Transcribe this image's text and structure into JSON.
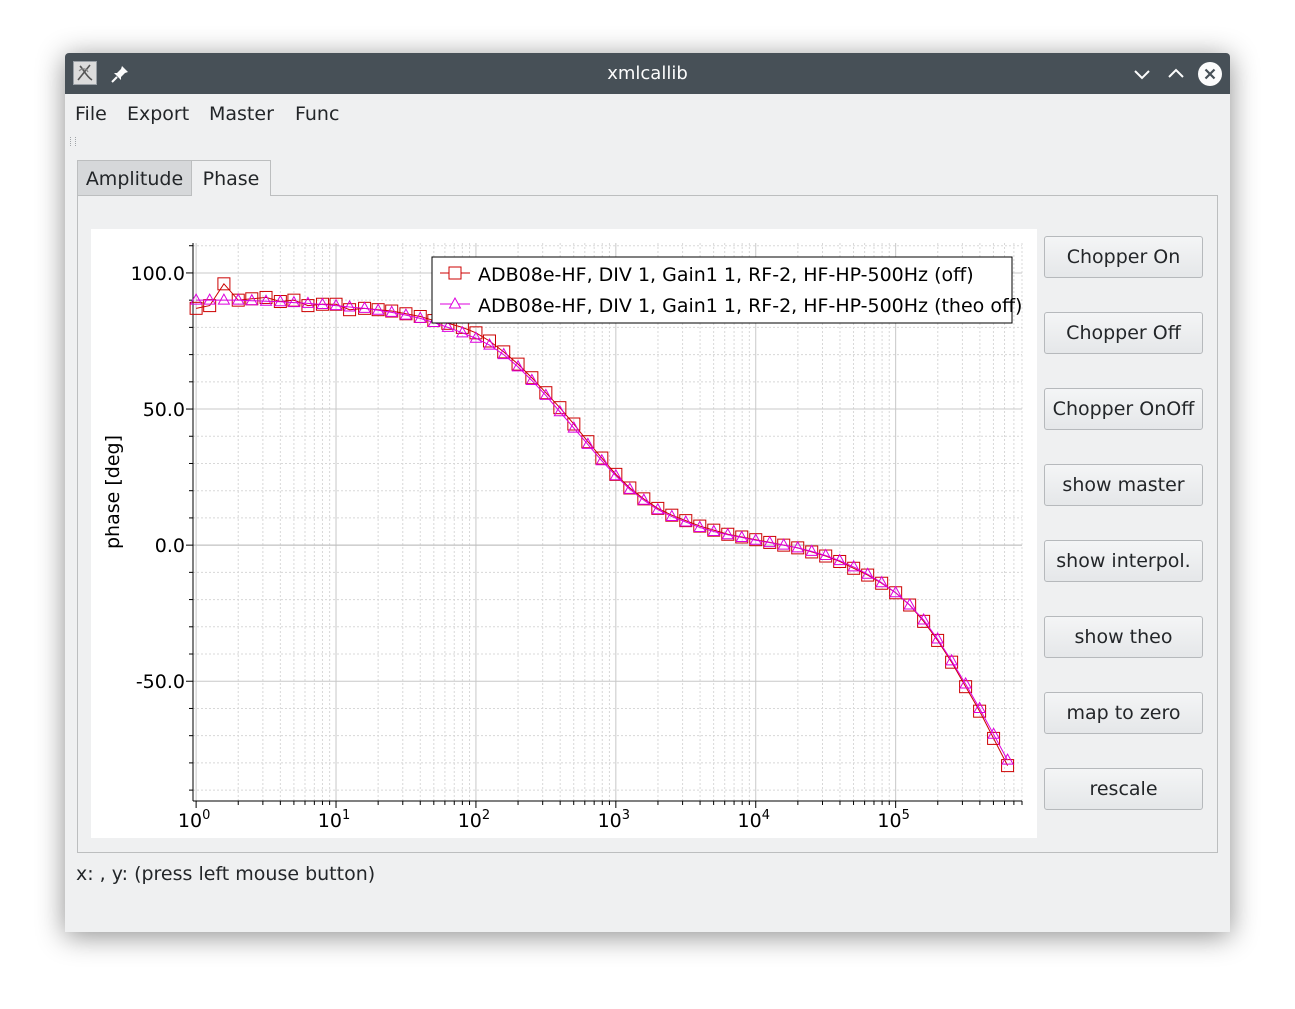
{
  "window": {
    "title": "xmlcallib"
  },
  "titlebar": {
    "app_icon": "xmlcallib-app-icon",
    "pin_icon": "pin-icon",
    "minimize_icon": "chevron-down-icon",
    "maximize_icon": "chevron-up-icon",
    "close_icon": "close-icon"
  },
  "menu": {
    "items": [
      "File",
      "Export",
      "Master",
      "Func"
    ]
  },
  "tabs": [
    {
      "label": "Amplitude",
      "active": false
    },
    {
      "label": "Phase",
      "active": true
    }
  ],
  "buttons": [
    "Chopper On",
    "Chopper Off",
    "Chopper OnOff",
    "show master",
    "show interpol.",
    "show theo",
    "map to zero",
    "rescale"
  ],
  "status": {
    "text": "x: , y: (press left mouse button)"
  },
  "colors": {
    "series_off": "#cc0000",
    "series_theo": "#dd00dd",
    "titlebar": "#475057",
    "window_bg": "#eff0f1"
  },
  "chart_data": {
    "type": "line",
    "ylabel": "phase [deg]",
    "xlabel": "",
    "xscale": "log",
    "xlim": [
      0.95,
      800000
    ],
    "ylim": [
      -94,
      111
    ],
    "x_ticks": [
      {
        "value": 1,
        "base": "10",
        "exp": "0"
      },
      {
        "value": 10,
        "base": "10",
        "exp": "1"
      },
      {
        "value": 100,
        "base": "10",
        "exp": "2"
      },
      {
        "value": 1000,
        "base": "10",
        "exp": "3"
      },
      {
        "value": 10000,
        "base": "10",
        "exp": "4"
      },
      {
        "value": 100000,
        "base": "10",
        "exp": "5"
      }
    ],
    "y_ticks": [
      {
        "value": 100,
        "label": "100.0"
      },
      {
        "value": 50,
        "label": "50.0"
      },
      {
        "value": 0,
        "label": "0.0"
      },
      {
        "value": -50,
        "label": "-50.0"
      }
    ],
    "grid": true,
    "legend_position": "top-right",
    "series": [
      {
        "name": "ADB08e-HF, DIV 1, Gain1 1, RF-2, HF-HP-500Hz (off)",
        "marker": "square",
        "color": "#cc0000",
        "x": [
          1,
          1.25,
          1.58,
          2,
          2.5,
          3.16,
          4,
          5,
          6.3,
          8,
          10,
          12.5,
          16,
          20,
          25,
          31.6,
          40,
          50,
          63,
          80,
          100,
          125,
          158,
          200,
          251,
          316,
          398,
          501,
          631,
          794,
          1000,
          1259,
          1585,
          1995,
          2512,
          3162,
          3981,
          5012,
          6310,
          7943,
          10000,
          12589,
          15849,
          19953,
          25119,
          31623,
          39811,
          50119,
          63096,
          79433,
          100000,
          125893,
          158489,
          199526,
          251189,
          316228,
          398107,
          501187,
          630957
        ],
        "y": [
          87,
          88,
          96,
          90,
          90.5,
          91,
          89.5,
          90,
          88,
          88.5,
          88.5,
          86.5,
          87,
          86.5,
          86,
          85,
          84,
          82.5,
          81.5,
          80,
          78,
          75,
          71,
          66.5,
          61.5,
          56,
          50.5,
          44.5,
          38,
          32,
          26,
          21,
          17,
          13.5,
          11,
          9,
          7,
          5.5,
          4,
          3,
          2,
          1,
          0,
          -1,
          -2.5,
          -4,
          -6,
          -8.5,
          -11,
          -14,
          -17.5,
          -22,
          -28,
          -35,
          -43,
          -52,
          -61,
          -71,
          -81
        ]
      },
      {
        "name": "ADB08e-HF, DIV 1, Gain1 1, RF-2, HF-HP-500Hz (theo off)",
        "marker": "triangle",
        "color": "#dd00dd",
        "x": [
          1,
          1.25,
          1.58,
          2,
          2.5,
          3.16,
          4,
          5,
          6.3,
          8,
          10,
          12.5,
          16,
          20,
          25,
          31.6,
          40,
          50,
          63,
          80,
          100,
          125,
          158,
          200,
          251,
          316,
          398,
          501,
          631,
          794,
          1000,
          1259,
          1585,
          1995,
          2512,
          3162,
          3981,
          5012,
          6310,
          7943,
          10000,
          12589,
          15849,
          19953,
          25119,
          31623,
          39811,
          50119,
          63096,
          79433,
          100000,
          125893,
          158489,
          199526,
          251189,
          316228,
          398107,
          501187,
          630957
        ],
        "y": [
          90,
          90,
          90,
          90,
          89.8,
          89.6,
          89.4,
          89.1,
          88.8,
          88.4,
          88,
          87.5,
          87,
          86.3,
          85.5,
          84.5,
          83.3,
          81.8,
          80,
          78,
          76,
          73.5,
          70,
          65.5,
          60.5,
          55,
          49,
          43,
          37,
          31,
          25.5,
          20.5,
          16.5,
          13,
          10.5,
          8.5,
          6.5,
          5,
          3.8,
          2.8,
          1.8,
          0.9,
          0,
          -1,
          -2.3,
          -3.8,
          -5.7,
          -8,
          -10.7,
          -13.8,
          -17.5,
          -22,
          -27.5,
          -34.5,
          -42.5,
          -51,
          -60,
          -69.5,
          -79
        ]
      }
    ]
  }
}
